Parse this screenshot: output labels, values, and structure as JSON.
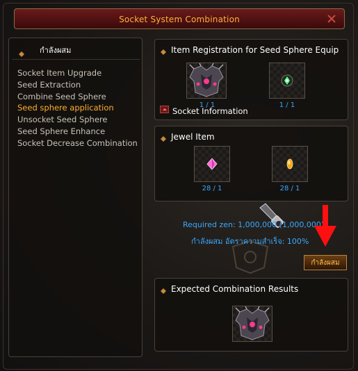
{
  "window": {
    "title": "Socket System Combination",
    "close_icon": "close-icon"
  },
  "sidebar": {
    "header": "กำลังผสม",
    "items": [
      {
        "label": "Socket Item Upgrade",
        "active": false
      },
      {
        "label": "Seed Extraction",
        "active": false
      },
      {
        "label": "Combine Seed Sphere",
        "active": false
      },
      {
        "label": "Seed sphere application",
        "active": true
      },
      {
        "label": "Unsocket Seed Sphere",
        "active": false
      },
      {
        "label": "Seed Sphere Enhance",
        "active": false
      },
      {
        "label": "Socket Decrease Combination",
        "active": false
      }
    ]
  },
  "registration": {
    "header": "Item Registration for Seed Sphere Equip",
    "slots": [
      {
        "icon": "armor-icon",
        "count": "1 / 1"
      },
      {
        "icon": "seed-sphere-icon",
        "count": "1 / 1"
      }
    ]
  },
  "socket_info": {
    "label": "Socket Information"
  },
  "jewel": {
    "header": "Jewel Item",
    "slots": [
      {
        "icon": "pink-jewel-icon",
        "count": "28 / 1"
      },
      {
        "icon": "gold-jewel-icon",
        "count": "28 / 1"
      }
    ]
  },
  "cost": {
    "required_zen": "Required zen: 1,000,000 (1,000,000)",
    "success_rate": "กำลังผสม อัตราความสำเร็จ: 100%"
  },
  "combine_button": {
    "label": "กำลังผสม"
  },
  "result": {
    "header": "Expected Combination Results",
    "slot": {
      "icon": "armor-icon"
    }
  },
  "colors": {
    "accent_orange": "#ffae2b",
    "info_blue": "#3aa8ff",
    "title_red": "#6a1a1a"
  }
}
